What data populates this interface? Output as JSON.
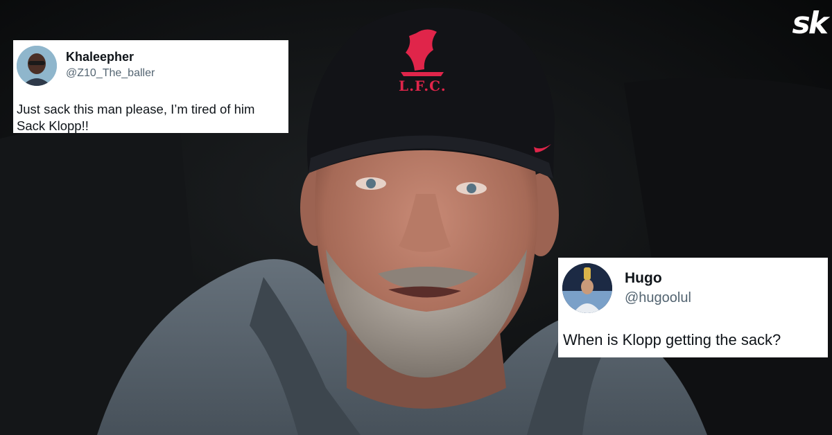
{
  "brand": {
    "logo_text": "sk",
    "color": "#ffffff"
  },
  "photo": {
    "cap_badge_text": "L.F.C.",
    "cap_color": "#111216",
    "badge_color": "#e0254a",
    "hoodie_color": "#5b6670"
  },
  "tweets": [
    {
      "name": "Khaleepher",
      "handle": "@Z10_The_baller",
      "text_lines": [
        "Just sack this man please, I’m tired of him",
        "Sack Klopp!!"
      ]
    },
    {
      "name": "Hugo",
      "handle": "@hugoolul",
      "text_lines": [
        "When is Klopp getting the sack?"
      ]
    }
  ]
}
